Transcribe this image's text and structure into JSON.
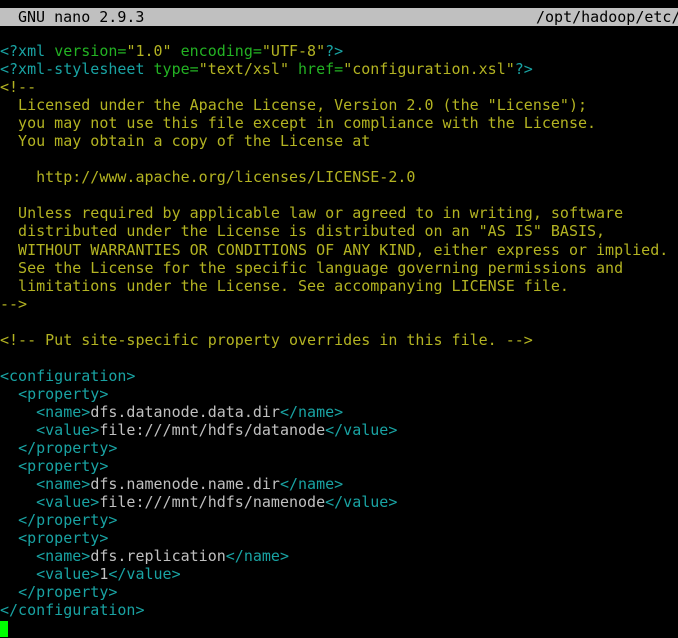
{
  "titlebar": {
    "app": "GNU nano 2.9.3",
    "path": "/opt/hadoop/etc/"
  },
  "lines": [
    {
      "segs": [
        [
          "tag",
          "<?xml "
        ],
        [
          "attr",
          "version="
        ],
        [
          "str",
          "\"1.0\""
        ],
        [
          "attr",
          " encoding="
        ],
        [
          "str",
          "\"UTF-8\""
        ],
        [
          "tag",
          "?>"
        ]
      ]
    },
    {
      "segs": [
        [
          "tag",
          "<?xml-stylesheet "
        ],
        [
          "attr",
          "type="
        ],
        [
          "str",
          "\"text/xsl\""
        ],
        [
          "attr",
          " href="
        ],
        [
          "str",
          "\"configuration.xsl\""
        ],
        [
          "tag",
          "?>"
        ]
      ]
    },
    {
      "segs": [
        [
          "cmt",
          "<!--"
        ]
      ]
    },
    {
      "segs": [
        [
          "cmt",
          "  Licensed under the Apache License, Version 2.0 (the \"License\");"
        ]
      ]
    },
    {
      "segs": [
        [
          "cmt",
          "  you may not use this file except in compliance with the License."
        ]
      ]
    },
    {
      "segs": [
        [
          "cmt",
          "  You may obtain a copy of the License at"
        ]
      ]
    },
    {
      "segs": [
        [
          "cmt",
          ""
        ]
      ]
    },
    {
      "segs": [
        [
          "cmt",
          "    http://www.apache.org/licenses/LICENSE-2.0"
        ]
      ]
    },
    {
      "segs": [
        [
          "cmt",
          ""
        ]
      ]
    },
    {
      "segs": [
        [
          "cmt",
          "  Unless required by applicable law or agreed to in writing, software"
        ]
      ]
    },
    {
      "segs": [
        [
          "cmt",
          "  distributed under the License is distributed on an \"AS IS\" BASIS,"
        ]
      ]
    },
    {
      "segs": [
        [
          "cmt",
          "  WITHOUT WARRANTIES OR CONDITIONS OF ANY KIND, either express or implied."
        ]
      ]
    },
    {
      "segs": [
        [
          "cmt",
          "  See the License for the specific language governing permissions and"
        ]
      ]
    },
    {
      "segs": [
        [
          "cmt",
          "  limitations under the License. See accompanying LICENSE file."
        ]
      ]
    },
    {
      "segs": [
        [
          "cmt",
          "-->"
        ]
      ]
    },
    {
      "segs": [
        [
          "cmt",
          ""
        ]
      ]
    },
    {
      "segs": [
        [
          "cmt",
          "<!-- Put site-specific property overrides in this file. -->"
        ]
      ]
    },
    {
      "segs": [
        [
          "txt",
          ""
        ]
      ]
    },
    {
      "segs": [
        [
          "tag",
          "<configuration>"
        ]
      ]
    },
    {
      "segs": [
        [
          "txt",
          "  "
        ],
        [
          "tag",
          "<property>"
        ]
      ]
    },
    {
      "segs": [
        [
          "txt",
          "    "
        ],
        [
          "tag",
          "<name>"
        ],
        [
          "txt",
          "dfs.datanode.data.dir"
        ],
        [
          "tag",
          "</name>"
        ]
      ]
    },
    {
      "segs": [
        [
          "txt",
          "    "
        ],
        [
          "tag",
          "<value>"
        ],
        [
          "txt",
          "file:///mnt/hdfs/datanode"
        ],
        [
          "tag",
          "</value>"
        ]
      ]
    },
    {
      "segs": [
        [
          "txt",
          "  "
        ],
        [
          "tag",
          "</property>"
        ]
      ]
    },
    {
      "segs": [
        [
          "txt",
          "  "
        ],
        [
          "tag",
          "<property>"
        ]
      ]
    },
    {
      "segs": [
        [
          "txt",
          "    "
        ],
        [
          "tag",
          "<name>"
        ],
        [
          "txt",
          "dfs.namenode.name.dir"
        ],
        [
          "tag",
          "</name>"
        ]
      ]
    },
    {
      "segs": [
        [
          "txt",
          "    "
        ],
        [
          "tag",
          "<value>"
        ],
        [
          "txt",
          "file:///mnt/hdfs/namenode"
        ],
        [
          "tag",
          "</value>"
        ]
      ]
    },
    {
      "segs": [
        [
          "txt",
          "  "
        ],
        [
          "tag",
          "</property>"
        ]
      ]
    },
    {
      "segs": [
        [
          "txt",
          "  "
        ],
        [
          "tag",
          "<property>"
        ]
      ]
    },
    {
      "segs": [
        [
          "txt",
          "    "
        ],
        [
          "tag",
          "<name>"
        ],
        [
          "txt",
          "dfs.replication"
        ],
        [
          "tag",
          "</name>"
        ]
      ]
    },
    {
      "segs": [
        [
          "txt",
          "    "
        ],
        [
          "tag",
          "<value>"
        ],
        [
          "txt",
          "1"
        ],
        [
          "tag",
          "</value>"
        ]
      ]
    },
    {
      "segs": [
        [
          "txt",
          "  "
        ],
        [
          "tag",
          "</property>"
        ]
      ]
    },
    {
      "segs": [
        [
          "tag",
          "</configuration>"
        ]
      ]
    }
  ],
  "colors": {
    "titlebar_bg": "#c0c0c0",
    "tag": "#19a3a3",
    "attribute": "#23b223",
    "string": "#b3b322",
    "comment": "#b3b322",
    "text": "#c0c0c0",
    "cursor": "#00ff00"
  }
}
